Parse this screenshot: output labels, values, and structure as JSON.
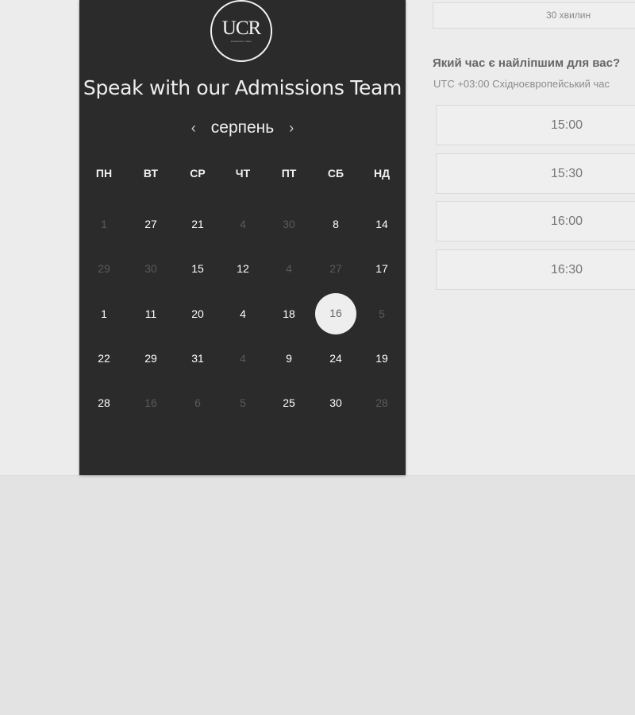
{
  "calendar": {
    "logo_text": "UCR",
    "logo_subtext": "Admissions Team",
    "title": "Speak with our Admissions Team",
    "month": "серпень",
    "prev_arrow": "‹",
    "next_arrow": "›",
    "weekdays": [
      "ПН",
      "ВТ",
      "СР",
      "ЧТ",
      "ПТ",
      "СБ",
      "НД"
    ],
    "weeks": [
      [
        "1",
        "27",
        "21",
        "4",
        "30",
        "8",
        "14"
      ],
      [
        "29",
        "30",
        "15",
        "12",
        "4",
        "27",
        "17"
      ],
      [
        "1",
        "11",
        "20",
        "4",
        "18",
        "16",
        "5"
      ],
      [
        "22",
        "29",
        "31",
        "4",
        "9",
        "24",
        "19"
      ],
      [
        "28",
        "16",
        "6",
        "5",
        "25",
        "30",
        "28"
      ]
    ],
    "selected_day": "16"
  },
  "booking": {
    "duration": "30 хвилин",
    "question": "Який час є найліпшим для вас?",
    "timezone": "UTC +03:00 Східноєвропейський час",
    "slots": [
      "15:00",
      "15:30",
      "16:00",
      "16:30"
    ]
  },
  "colors": {
    "panel_bg": "#2b2b2b",
    "page_bg": "#ececec",
    "selected_bg": "#eeeeee"
  }
}
